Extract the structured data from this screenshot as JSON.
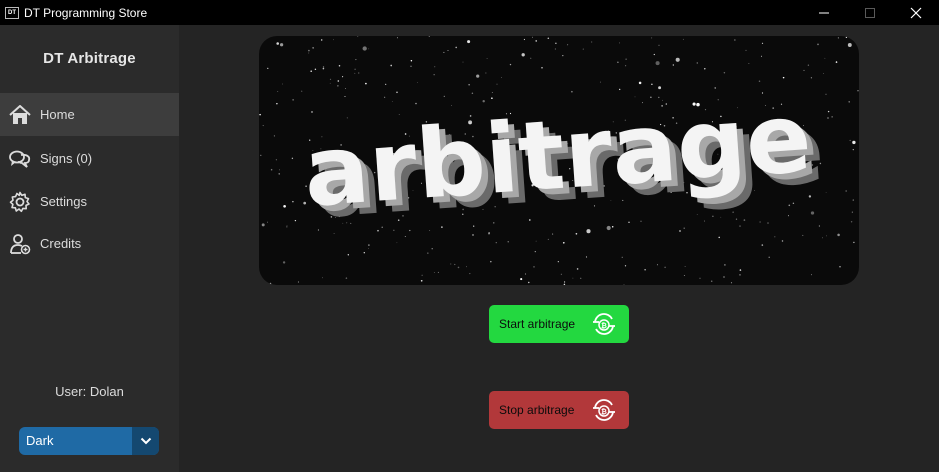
{
  "window": {
    "app_icon_text": "DT",
    "title": "DT Programming Store",
    "controls": [
      "minimize-icon",
      "maximize-icon",
      "close-icon"
    ]
  },
  "sidebar": {
    "brand": "DT Arbitrage",
    "items": [
      {
        "label": "Home",
        "icon": "home-icon",
        "active": true
      },
      {
        "label": "Signs (0)",
        "icon": "chat-bubbles-icon",
        "active": false
      },
      {
        "label": "Settings",
        "icon": "gear-icon",
        "active": false
      },
      {
        "label": "Credits",
        "icon": "user-plus-icon",
        "active": false
      }
    ],
    "user_label": "User: Dolan",
    "theme": {
      "selected": "Dark",
      "accent": "#1f6aa5"
    }
  },
  "main": {
    "banner": {
      "text": "arbitrage"
    },
    "start_button": {
      "label": "Start arbitrage",
      "icon": "bitcoin-exchange-icon",
      "color": "#23d840"
    },
    "stop_button": {
      "label": "Stop arbitrage",
      "icon": "bitcoin-exchange-icon",
      "color": "#b2383a"
    }
  }
}
